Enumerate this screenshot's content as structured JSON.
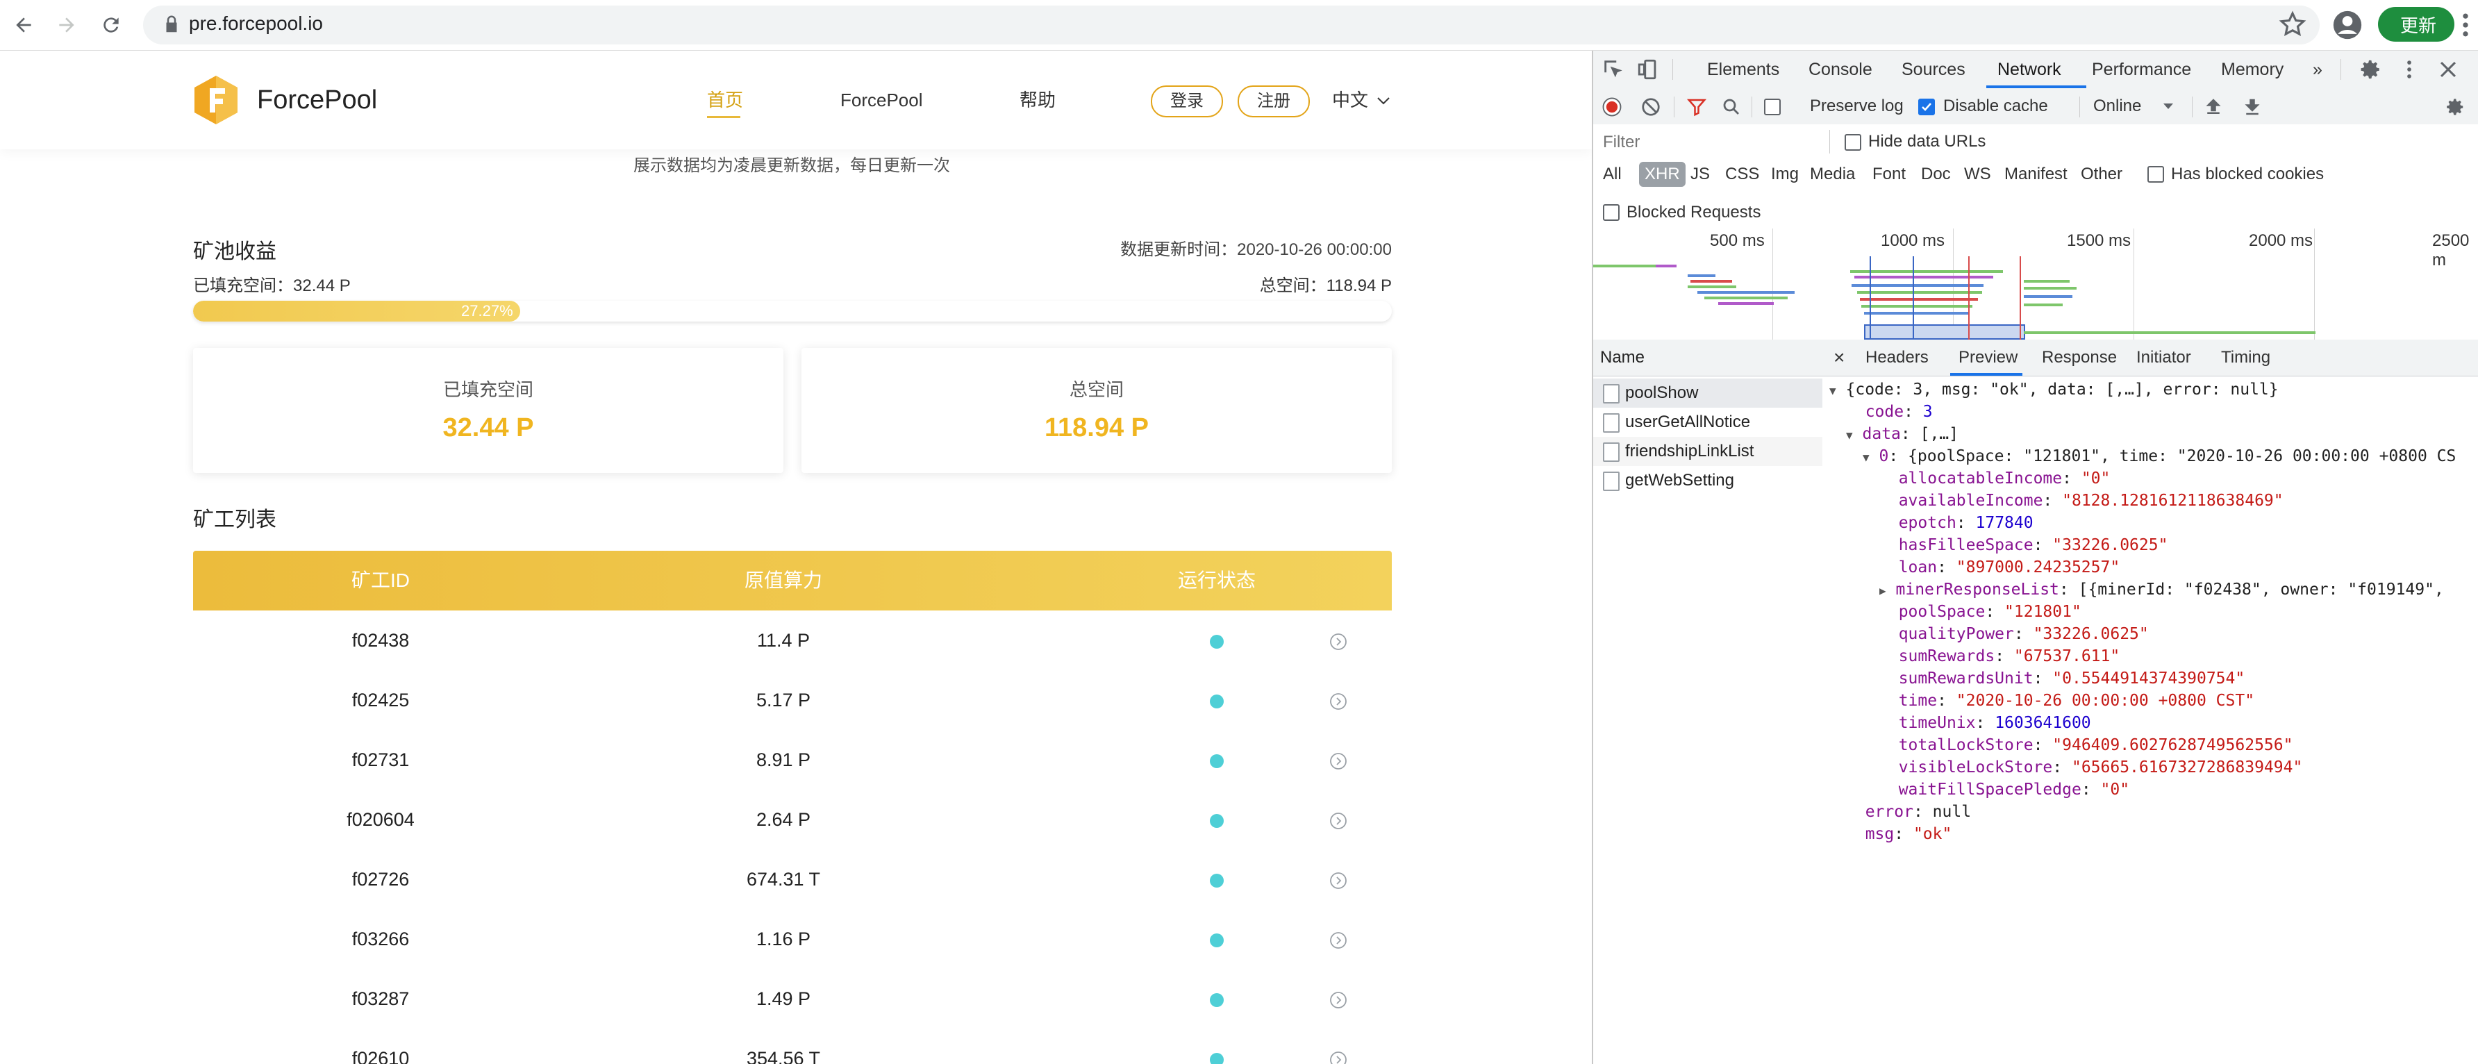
{
  "browser": {
    "url": "pre.forcepool.io",
    "update_label": "更新"
  },
  "site": {
    "brand": "ForcePool",
    "nav": [
      "首页",
      "ForcePool",
      "帮助"
    ],
    "login": "登录",
    "register": "注册",
    "lang": "中文",
    "notice": "展示数据均为凌晨更新数据，每日更新一次"
  },
  "income": {
    "title": "矿池收益",
    "update_time": "数据更新时间：2020-10-26 00:00:00",
    "filled_line": "已填充空间：32.44 P",
    "total_line": "总空间：118.94 P",
    "progress_label": "27.27%",
    "progress_value": 27.27,
    "card_filled_label": "已填充空间",
    "card_filled_value": "32.44 P",
    "card_total_label": "总空间",
    "card_total_value": "118.94 P"
  },
  "miners": {
    "title": "矿工列表",
    "columns": [
      "矿工ID",
      "原值算力",
      "运行状态"
    ],
    "rows": [
      {
        "id": "f02438",
        "power": "11.4 P"
      },
      {
        "id": "f02425",
        "power": "5.17 P"
      },
      {
        "id": "f02731",
        "power": "8.91 P"
      },
      {
        "id": "f020604",
        "power": "2.64 P"
      },
      {
        "id": "f02726",
        "power": "674.31 T"
      },
      {
        "id": "f03266",
        "power": "1.16 P"
      },
      {
        "id": "f03287",
        "power": "1.49 P"
      },
      {
        "id": "f02610",
        "power": "354.56 T"
      }
    ]
  },
  "devtools": {
    "tabs": [
      "Elements",
      "Console",
      "Sources",
      "Network",
      "Performance",
      "Memory",
      "»"
    ],
    "toolbar": {
      "preserve_log": "Preserve log",
      "disable_cache": "Disable cache",
      "throttle": "Online"
    },
    "filter_placeholder": "Filter",
    "hide_data_urls": "Hide data URLs",
    "types": [
      "All",
      "XHR",
      "JS",
      "CSS",
      "Img",
      "Media",
      "Font",
      "Doc",
      "WS",
      "Manifest",
      "Other"
    ],
    "has_blocked_cookies": "Has blocked cookies",
    "blocked_requests": "Blocked Requests",
    "timeline_ticks": [
      "500 ms",
      "1000 ms",
      "1500 ms",
      "2000 ms",
      "2500 m"
    ],
    "name_header": "Name",
    "requests": [
      "poolShow",
      "userGetAllNotice",
      "friendshipLinkList",
      "getWebSetting"
    ],
    "detail_tabs": [
      "×",
      "Headers",
      "Preview",
      "Response",
      "Initiator",
      "Timing"
    ],
    "json_lines": [
      {
        "indent": 0,
        "tri": "▼",
        "key": "",
        "text": "{code: 3, msg: \"ok\", data: [,…], error: null}",
        "type": "p"
      },
      {
        "indent": 1,
        "tri": "",
        "key": "code",
        "text": "3",
        "type": "n"
      },
      {
        "indent": 1,
        "tri": "▼",
        "key": "data",
        "text": "[,…]",
        "type": "p"
      },
      {
        "indent": 2,
        "tri": "▼",
        "key": "0",
        "text": "{poolSpace: \"121801\", time: \"2020-10-26 00:00:00 +0800 CS",
        "type": "p"
      },
      {
        "indent": 3,
        "tri": "",
        "key": "allocatableIncome",
        "text": "\"0\"",
        "type": "s"
      },
      {
        "indent": 3,
        "tri": "",
        "key": "availableIncome",
        "text": "\"8128.1281612118638469\"",
        "type": "s"
      },
      {
        "indent": 3,
        "tri": "",
        "key": "epotch",
        "text": "177840",
        "type": "n"
      },
      {
        "indent": 3,
        "tri": "",
        "key": "hasFilleeSpace",
        "text": "\"33226.0625\"",
        "type": "s"
      },
      {
        "indent": 3,
        "tri": "",
        "key": "loan",
        "text": "\"897000.24235257\"",
        "type": "s"
      },
      {
        "indent": 3,
        "tri": "▶",
        "key": "minerResponseList",
        "text": "[{minerId: \"f02438\", owner: \"f019149\",",
        "type": "p"
      },
      {
        "indent": 3,
        "tri": "",
        "key": "poolSpace",
        "text": "\"121801\"",
        "type": "s"
      },
      {
        "indent": 3,
        "tri": "",
        "key": "qualityPower",
        "text": "\"33226.0625\"",
        "type": "s"
      },
      {
        "indent": 3,
        "tri": "",
        "key": "sumRewards",
        "text": "\"67537.611\"",
        "type": "s"
      },
      {
        "indent": 3,
        "tri": "",
        "key": "sumRewardsUnit",
        "text": "\"0.5544914374390754\"",
        "type": "s"
      },
      {
        "indent": 3,
        "tri": "",
        "key": "time",
        "text": "\"2020-10-26 00:00:00 +0800 CST\"",
        "type": "s"
      },
      {
        "indent": 3,
        "tri": "",
        "key": "timeUnix",
        "text": "1603641600",
        "type": "n"
      },
      {
        "indent": 3,
        "tri": "",
        "key": "totalLockStore",
        "text": "\"946409.6027628749562556\"",
        "type": "s"
      },
      {
        "indent": 3,
        "tri": "",
        "key": "visibleLockStore",
        "text": "\"65665.6167327286839494\"",
        "type": "s"
      },
      {
        "indent": 3,
        "tri": "",
        "key": "waitFillSpacePledge",
        "text": "\"0\"",
        "type": "s"
      },
      {
        "indent": 1,
        "tri": "",
        "key": "error",
        "text": "null",
        "type": "p"
      },
      {
        "indent": 1,
        "tri": "",
        "key": "msg",
        "text": "\"ok\"",
        "type": "s"
      }
    ]
  },
  "colors": {
    "accent_gold": "#f0b520",
    "status_teal": "#4ecfd6",
    "devtools_blue": "#1a73e8",
    "update_green": "#1e8e3e"
  }
}
